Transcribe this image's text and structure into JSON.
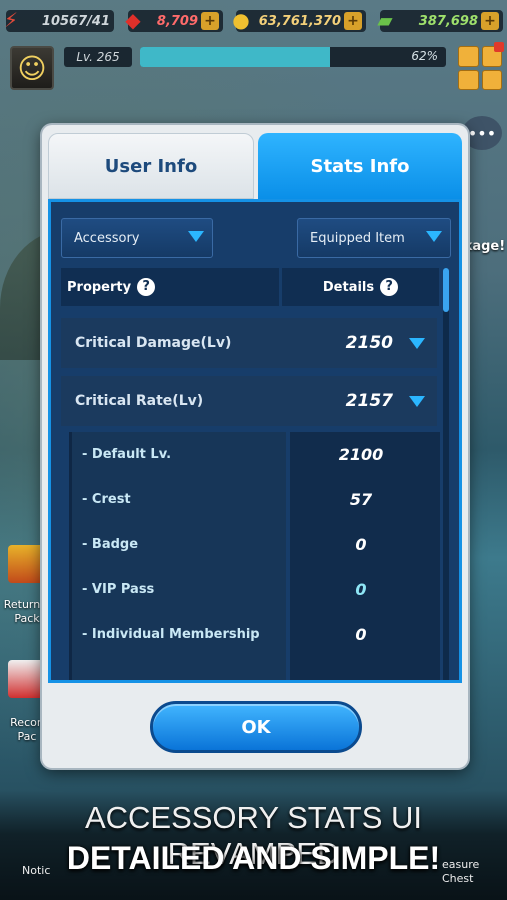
{
  "hud": {
    "energy": "10567/41",
    "ruby": "8,709",
    "gold": "63,761,370",
    "cash": "387,698",
    "level": "Lv. 265",
    "xp_percent_label": "62%",
    "xp_progress": 0.62,
    "icons": {
      "energy": "lightning-icon",
      "ruby": "ruby-gem-icon",
      "gold": "gold-coins-icon",
      "cash": "cash-stack-icon",
      "add": "plus-icon",
      "menu": "grid-menu-icon",
      "chat": "chat-bubble-icon"
    }
  },
  "background": {
    "right_label": "g\nckage!",
    "left_item_1": "Returnin\nPack",
    "left_item_2": "Recon\nPac",
    "bottom_left": "Notic",
    "bottom_right": "easure\nChest"
  },
  "dialog": {
    "tabs": [
      {
        "label": "User Info",
        "active": false
      },
      {
        "label": "Stats Info",
        "active": true
      }
    ],
    "filter_left": "Accessory",
    "filter_right": "Equipped Item",
    "columns": {
      "property": "Property",
      "details": "Details"
    },
    "rows": [
      {
        "label": "Critical Damage(Lv)",
        "value": "2150",
        "expanded": false
      },
      {
        "label": "Critical Rate(Lv)",
        "value": "2157",
        "expanded": true
      }
    ],
    "sub_rows": [
      {
        "label": "- Default Lv.",
        "value": "2100"
      },
      {
        "label": "- Crest",
        "value": "57"
      },
      {
        "label": "- Badge",
        "value": "0"
      },
      {
        "label": "- VIP Pass",
        "value": "0"
      },
      {
        "label": "- Individual Membership",
        "value": "0"
      }
    ],
    "ok_label": "OK"
  },
  "caption": {
    "line1": "ACCESSORY STATS UI REVAMPED",
    "line2": "DETAILED AND SIMPLE!"
  },
  "colors": {
    "tab_active": "#0a8fe8",
    "panel": "#173d6a",
    "accent": "#2bb6ff",
    "ok_button": "#0a74d8"
  }
}
